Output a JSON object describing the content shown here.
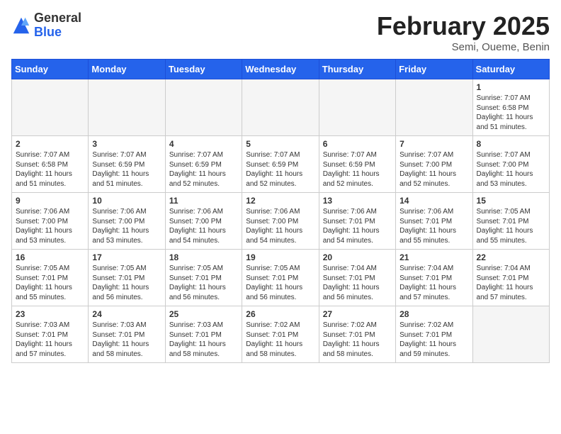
{
  "header": {
    "logo_general": "General",
    "logo_blue": "Blue",
    "title": "February 2025",
    "subtitle": "Semi, Oueme, Benin"
  },
  "days_of_week": [
    "Sunday",
    "Monday",
    "Tuesday",
    "Wednesday",
    "Thursday",
    "Friday",
    "Saturday"
  ],
  "weeks": [
    [
      {
        "day": "",
        "info": ""
      },
      {
        "day": "",
        "info": ""
      },
      {
        "day": "",
        "info": ""
      },
      {
        "day": "",
        "info": ""
      },
      {
        "day": "",
        "info": ""
      },
      {
        "day": "",
        "info": ""
      },
      {
        "day": "1",
        "info": "Sunrise: 7:07 AM\nSunset: 6:58 PM\nDaylight: 11 hours\nand 51 minutes."
      }
    ],
    [
      {
        "day": "2",
        "info": "Sunrise: 7:07 AM\nSunset: 6:58 PM\nDaylight: 11 hours\nand 51 minutes."
      },
      {
        "day": "3",
        "info": "Sunrise: 7:07 AM\nSunset: 6:59 PM\nDaylight: 11 hours\nand 51 minutes."
      },
      {
        "day": "4",
        "info": "Sunrise: 7:07 AM\nSunset: 6:59 PM\nDaylight: 11 hours\nand 52 minutes."
      },
      {
        "day": "5",
        "info": "Sunrise: 7:07 AM\nSunset: 6:59 PM\nDaylight: 11 hours\nand 52 minutes."
      },
      {
        "day": "6",
        "info": "Sunrise: 7:07 AM\nSunset: 6:59 PM\nDaylight: 11 hours\nand 52 minutes."
      },
      {
        "day": "7",
        "info": "Sunrise: 7:07 AM\nSunset: 7:00 PM\nDaylight: 11 hours\nand 52 minutes."
      },
      {
        "day": "8",
        "info": "Sunrise: 7:07 AM\nSunset: 7:00 PM\nDaylight: 11 hours\nand 53 minutes."
      }
    ],
    [
      {
        "day": "9",
        "info": "Sunrise: 7:06 AM\nSunset: 7:00 PM\nDaylight: 11 hours\nand 53 minutes."
      },
      {
        "day": "10",
        "info": "Sunrise: 7:06 AM\nSunset: 7:00 PM\nDaylight: 11 hours\nand 53 minutes."
      },
      {
        "day": "11",
        "info": "Sunrise: 7:06 AM\nSunset: 7:00 PM\nDaylight: 11 hours\nand 54 minutes."
      },
      {
        "day": "12",
        "info": "Sunrise: 7:06 AM\nSunset: 7:00 PM\nDaylight: 11 hours\nand 54 minutes."
      },
      {
        "day": "13",
        "info": "Sunrise: 7:06 AM\nSunset: 7:01 PM\nDaylight: 11 hours\nand 54 minutes."
      },
      {
        "day": "14",
        "info": "Sunrise: 7:06 AM\nSunset: 7:01 PM\nDaylight: 11 hours\nand 55 minutes."
      },
      {
        "day": "15",
        "info": "Sunrise: 7:05 AM\nSunset: 7:01 PM\nDaylight: 11 hours\nand 55 minutes."
      }
    ],
    [
      {
        "day": "16",
        "info": "Sunrise: 7:05 AM\nSunset: 7:01 PM\nDaylight: 11 hours\nand 55 minutes."
      },
      {
        "day": "17",
        "info": "Sunrise: 7:05 AM\nSunset: 7:01 PM\nDaylight: 11 hours\nand 56 minutes."
      },
      {
        "day": "18",
        "info": "Sunrise: 7:05 AM\nSunset: 7:01 PM\nDaylight: 11 hours\nand 56 minutes."
      },
      {
        "day": "19",
        "info": "Sunrise: 7:05 AM\nSunset: 7:01 PM\nDaylight: 11 hours\nand 56 minutes."
      },
      {
        "day": "20",
        "info": "Sunrise: 7:04 AM\nSunset: 7:01 PM\nDaylight: 11 hours\nand 56 minutes."
      },
      {
        "day": "21",
        "info": "Sunrise: 7:04 AM\nSunset: 7:01 PM\nDaylight: 11 hours\nand 57 minutes."
      },
      {
        "day": "22",
        "info": "Sunrise: 7:04 AM\nSunset: 7:01 PM\nDaylight: 11 hours\nand 57 minutes."
      }
    ],
    [
      {
        "day": "23",
        "info": "Sunrise: 7:03 AM\nSunset: 7:01 PM\nDaylight: 11 hours\nand 57 minutes."
      },
      {
        "day": "24",
        "info": "Sunrise: 7:03 AM\nSunset: 7:01 PM\nDaylight: 11 hours\nand 58 minutes."
      },
      {
        "day": "25",
        "info": "Sunrise: 7:03 AM\nSunset: 7:01 PM\nDaylight: 11 hours\nand 58 minutes."
      },
      {
        "day": "26",
        "info": "Sunrise: 7:02 AM\nSunset: 7:01 PM\nDaylight: 11 hours\nand 58 minutes."
      },
      {
        "day": "27",
        "info": "Sunrise: 7:02 AM\nSunset: 7:01 PM\nDaylight: 11 hours\nand 58 minutes."
      },
      {
        "day": "28",
        "info": "Sunrise: 7:02 AM\nSunset: 7:01 PM\nDaylight: 11 hours\nand 59 minutes."
      },
      {
        "day": "",
        "info": ""
      }
    ]
  ]
}
